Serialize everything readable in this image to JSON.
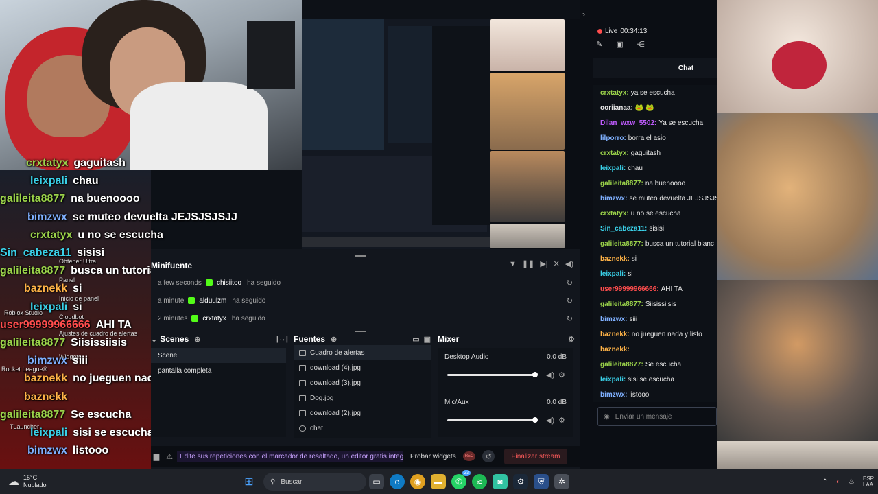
{
  "overlay_chat": [
    {
      "user": "crxtatyx",
      "msg": "gaguitash",
      "color": "#9bd34a"
    },
    {
      "user": "leixpali",
      "msg": "chau",
      "color": "#3ad0e8"
    },
    {
      "user": "galileita8877",
      "msg": "na buenoooo",
      "color": "#9bd34a"
    },
    {
      "user": "bimzwx",
      "msg": "se muteo devuelta JEJSJSJSJJ",
      "color": "#7fb0ff"
    },
    {
      "user": "crxtatyx",
      "msg": "u no se escucha",
      "color": "#9bd34a"
    },
    {
      "user": "Sin_cabeza11",
      "msg": "sisisi",
      "color": "#3ad0e8"
    },
    {
      "user": "galileita8877",
      "msg": "busca un tutorial bianchi",
      "color": "#9bd34a"
    },
    {
      "user": "baznekk",
      "msg": "si",
      "color": "#ffb347"
    },
    {
      "user": "leixpali",
      "msg": "si",
      "color": "#3ad0e8"
    },
    {
      "user": "user99999966666",
      "msg": "AHI TA",
      "color": "#ff4d4d"
    },
    {
      "user": "galileita8877",
      "msg": "Siisissiisis",
      "color": "#9bd34a"
    },
    {
      "user": "bimzwx",
      "msg": "siii",
      "color": "#7fb0ff"
    },
    {
      "user": "baznekk",
      "msg": "no jueguen nada y listo",
      "color": "#ffb347"
    },
    {
      "user": "baznekk",
      "msg": "",
      "color": "#ffb347"
    },
    {
      "user": "galileita8877",
      "msg": "Se escucha",
      "color": "#9bd34a"
    },
    {
      "user": "leixpali",
      "msg": "sisi se escucha",
      "color": "#3ad0e8"
    },
    {
      "user": "bimzwx",
      "msg": "listooo",
      "color": "#7fb0ff"
    }
  ],
  "desktop_labels": {
    "obtener_ultra": "Obtener Ultra",
    "panel": "Panel",
    "inicio_panel": "Inicio de panel",
    "cloudbot": "Cloudbot",
    "roblox": "Roblox Studio",
    "ajustes": "Ajustes de cuadro de alertas",
    "widgets": "Widgets",
    "rocket": "Rocket League®",
    "tlauncher": "TLauncher"
  },
  "minifuente": {
    "title": "Minifuente",
    "events": [
      {
        "time": "a few seconds",
        "user": "chisiitoo",
        "action": "ha seguido"
      },
      {
        "time": "a minute",
        "user": "alduulzm",
        "action": "ha seguido"
      },
      {
        "time": "2 minutes",
        "user": "crxtatyx",
        "action": "ha seguido"
      }
    ]
  },
  "scenes": {
    "title": "Scenes",
    "items": [
      "Scene",
      "pantalla completa"
    ]
  },
  "sources": {
    "title": "Fuentes",
    "items": [
      "Cuadro de alertas",
      "download (4).jpg",
      "download (3).jpg",
      "Dog.jpg",
      "download (2).jpg",
      "chat"
    ]
  },
  "mixer": {
    "title": "Mixer",
    "channels": [
      {
        "name": "Desktop Audio",
        "level": "0.0 dB",
        "volume": 0.98
      },
      {
        "name": "Mic/Aux",
        "level": "0.0 dB",
        "volume": 0.98
      }
    ]
  },
  "bottom_bar": {
    "promo": "Edite sus repeticiones con el marcador de resaltado, un editor gratis integrad",
    "test_widgets": "Probar widgets",
    "rec": "REC",
    "end_stream": "Finalizar stream"
  },
  "right_panel": {
    "live_label": "Live",
    "live_time": "00:34:13",
    "chat_title": "Chat",
    "messages": [
      {
        "user": "crxtatyx",
        "msg": "ya se escucha",
        "color": "#9bd34a"
      },
      {
        "user": "ooriianaa:",
        "msg": "🐸 🐸",
        "color": "#e6e6e6"
      },
      {
        "user": "Dilan_wxw_5502",
        "msg": "Ya se escucha",
        "color": "#c05cff"
      },
      {
        "user": "lilporro",
        "msg": "borra el asio",
        "color": "#7fb0ff"
      },
      {
        "user": "crxtatyx",
        "msg": "gaguitash",
        "color": "#9bd34a"
      },
      {
        "user": "leixpali",
        "msg": "chau",
        "color": "#3ad0e8"
      },
      {
        "user": "galileita8877",
        "msg": "na buenoooo",
        "color": "#9bd34a"
      },
      {
        "user": "bimzwx",
        "msg": "se muteo devuelta JEJSJSJS",
        "color": "#7fb0ff"
      },
      {
        "user": "crxtatyx",
        "msg": "u no se escucha",
        "color": "#9bd34a"
      },
      {
        "user": "Sin_cabeza11",
        "msg": "sisisi",
        "color": "#3ad0e8"
      },
      {
        "user": "galileita8877",
        "msg": "busca un tutorial bianc",
        "color": "#9bd34a"
      },
      {
        "user": "baznekk",
        "msg": "si",
        "color": "#ffb347"
      },
      {
        "user": "leixpali",
        "msg": "si",
        "color": "#3ad0e8"
      },
      {
        "user": "user99999966666",
        "msg": "AHI TA",
        "color": "#ff4d4d"
      },
      {
        "user": "galileita8877",
        "msg": "Siisissiisis",
        "color": "#9bd34a"
      },
      {
        "user": "bimzwx",
        "msg": "siii",
        "color": "#7fb0ff"
      },
      {
        "user": "baznekk",
        "msg": "no jueguen nada y listo",
        "color": "#ffb347"
      },
      {
        "user": "baznekk",
        "msg": "",
        "color": "#ffb347"
      },
      {
        "user": "galileita8877",
        "msg": "Se escucha",
        "color": "#9bd34a"
      },
      {
        "user": "leixpali",
        "msg": "sisi se escucha",
        "color": "#3ad0e8"
      },
      {
        "user": "bimzwx",
        "msg": "listooo",
        "color": "#7fb0ff"
      }
    ],
    "input_placeholder": "Enviar un mensaje"
  },
  "taskbar": {
    "temp": "15°C",
    "weather": "Nublado",
    "search_placeholder": "Buscar",
    "badge": "23",
    "tray_lang_1": "ESP",
    "tray_lang_2": "LAA"
  }
}
